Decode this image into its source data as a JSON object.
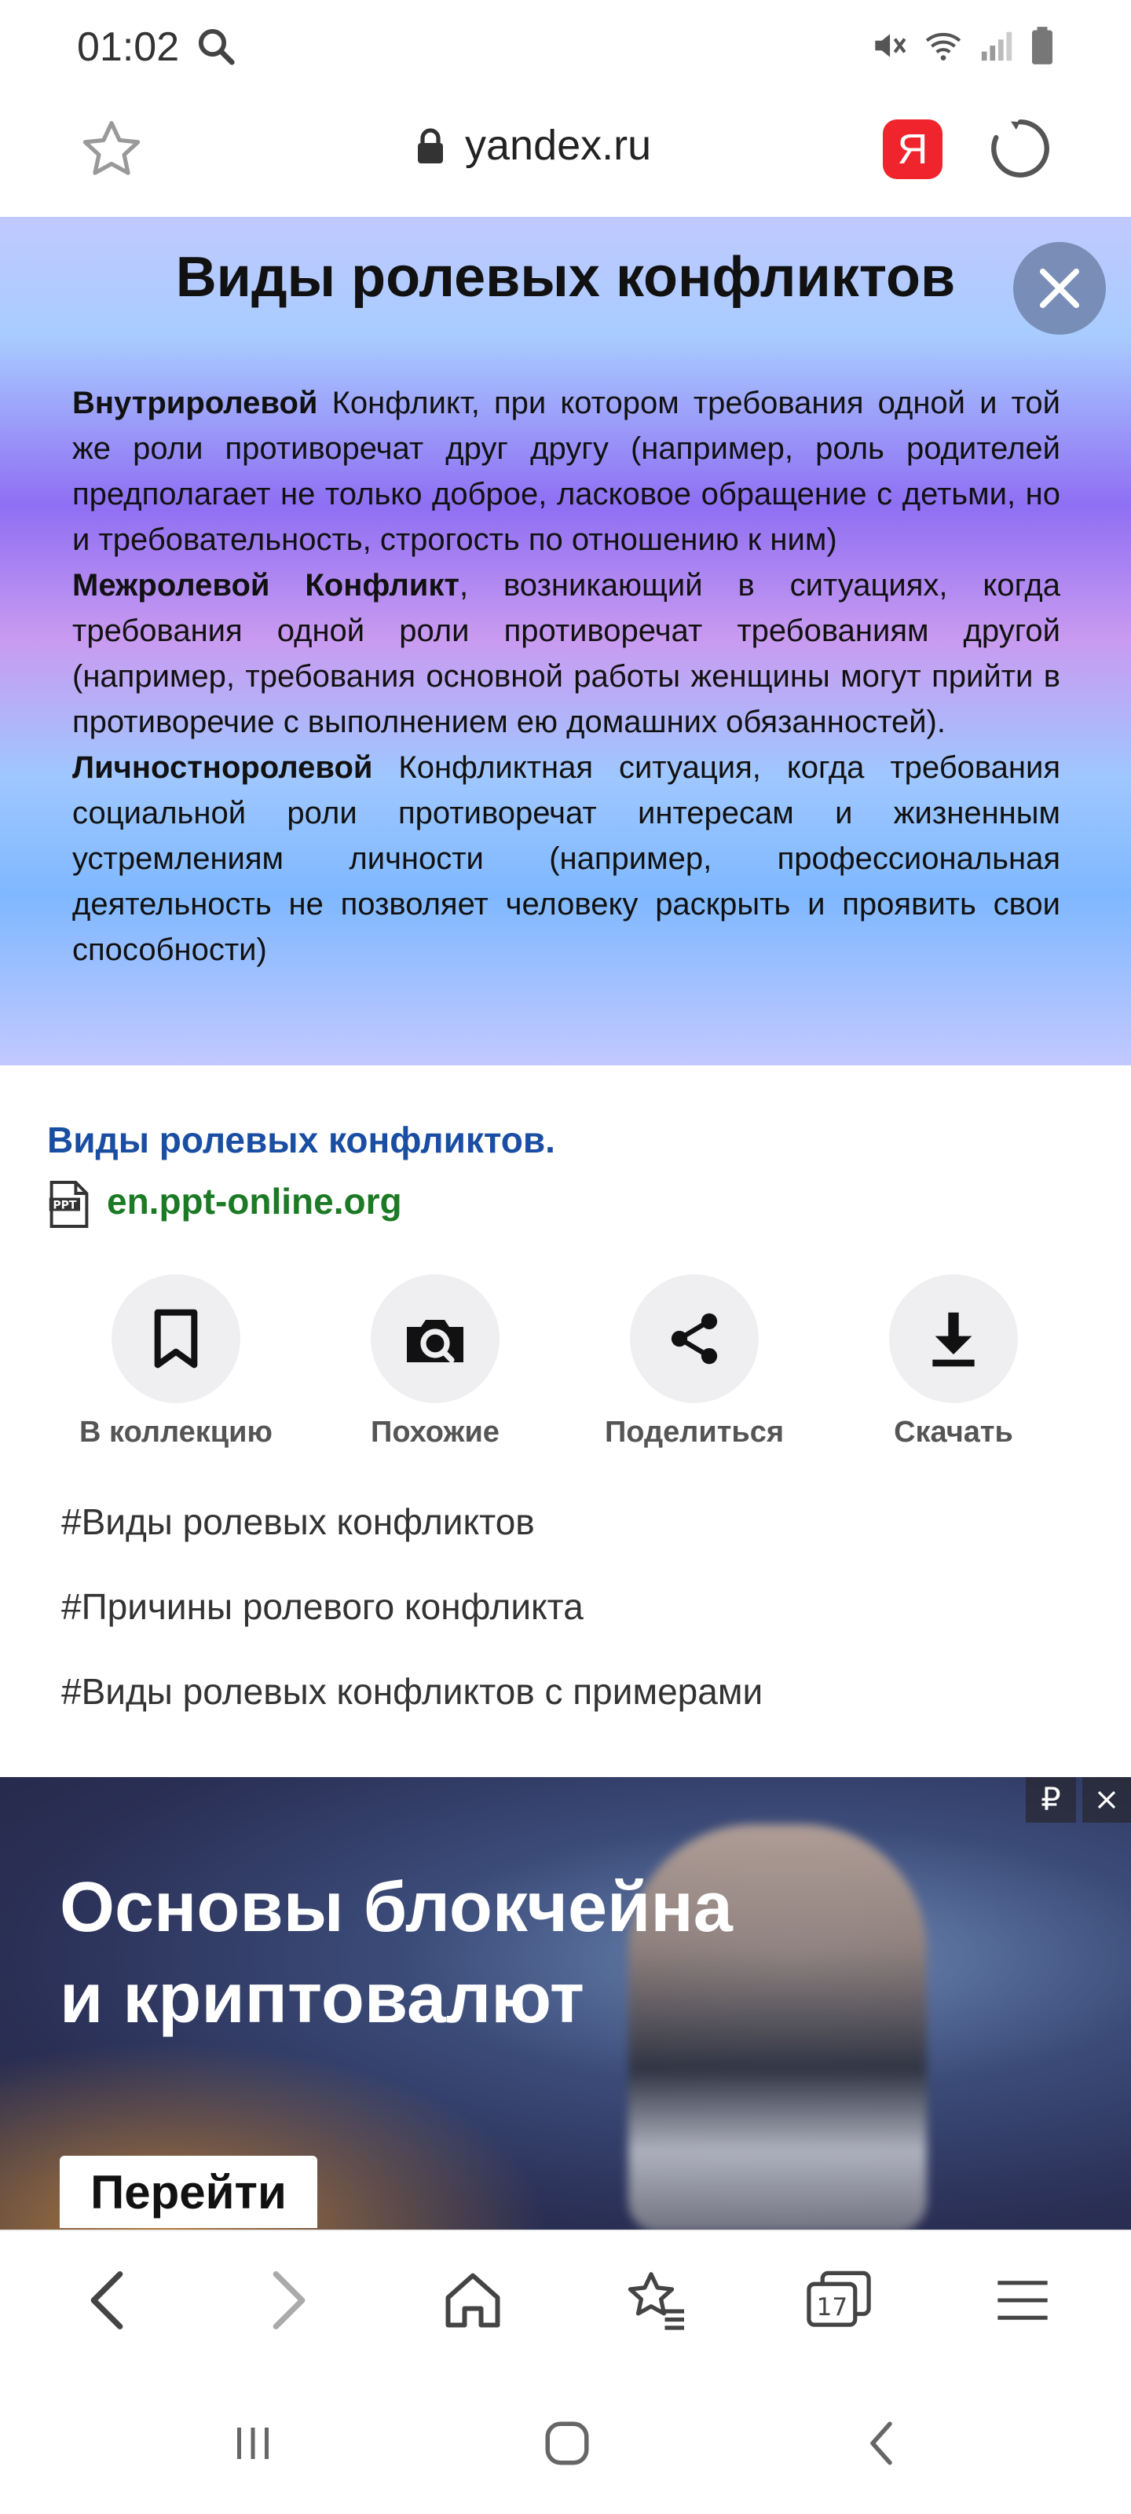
{
  "status_bar": {
    "time": "01:02"
  },
  "url_bar": {
    "url": "yandex.ru",
    "yandex_badge": "Я"
  },
  "slide": {
    "title": "Виды ролевых конфликтов",
    "paragraphs": [
      {
        "bold": "Внутриролевой",
        "text": " Конфликт, при котором требования одной и той же роли противоречат друг другу (например, роль родителей предполагает не только доброе, ласковое обращение с детьми, но и требовательность, строгость по отношению к ним)"
      },
      {
        "bold": "Межролевой Конфликт",
        "text": ", возникающий в ситуациях, когда требования одной роли противоречат требованиям другой (например, требования основной работы женщины могут прийти в противоречие с выполнением ею домашних обязанностей)."
      },
      {
        "bold": "Личностноролевой",
        "text": " Конфликтная ситуация, когда требования социальной роли противоречат интересам и жизненным устремлениям личности (например, профессиональная деятельность не позволяет человеку раскрыть и проявить свои способности)"
      }
    ]
  },
  "result": {
    "title": "Виды ролевых конфликтов.",
    "source": "en.ppt-online.org"
  },
  "actions": [
    {
      "label": "В коллекцию",
      "icon": "bookmark-icon"
    },
    {
      "label": "Похожие",
      "icon": "camera-search-icon"
    },
    {
      "label": "Поделиться",
      "icon": "share-icon"
    },
    {
      "label": "Скачать",
      "icon": "download-icon"
    }
  ],
  "tags": [
    "#Виды ролевых конфликтов",
    "#Причины ролевого конфликта",
    "#Виды ролевых конфликтов с примерами"
  ],
  "ad": {
    "headline_line1": "Основы блокчейна",
    "headline_line2": "и криптовалют",
    "button": "Перейти",
    "currency": "₽"
  },
  "browser_nav": {
    "tabs_count": "17"
  }
}
